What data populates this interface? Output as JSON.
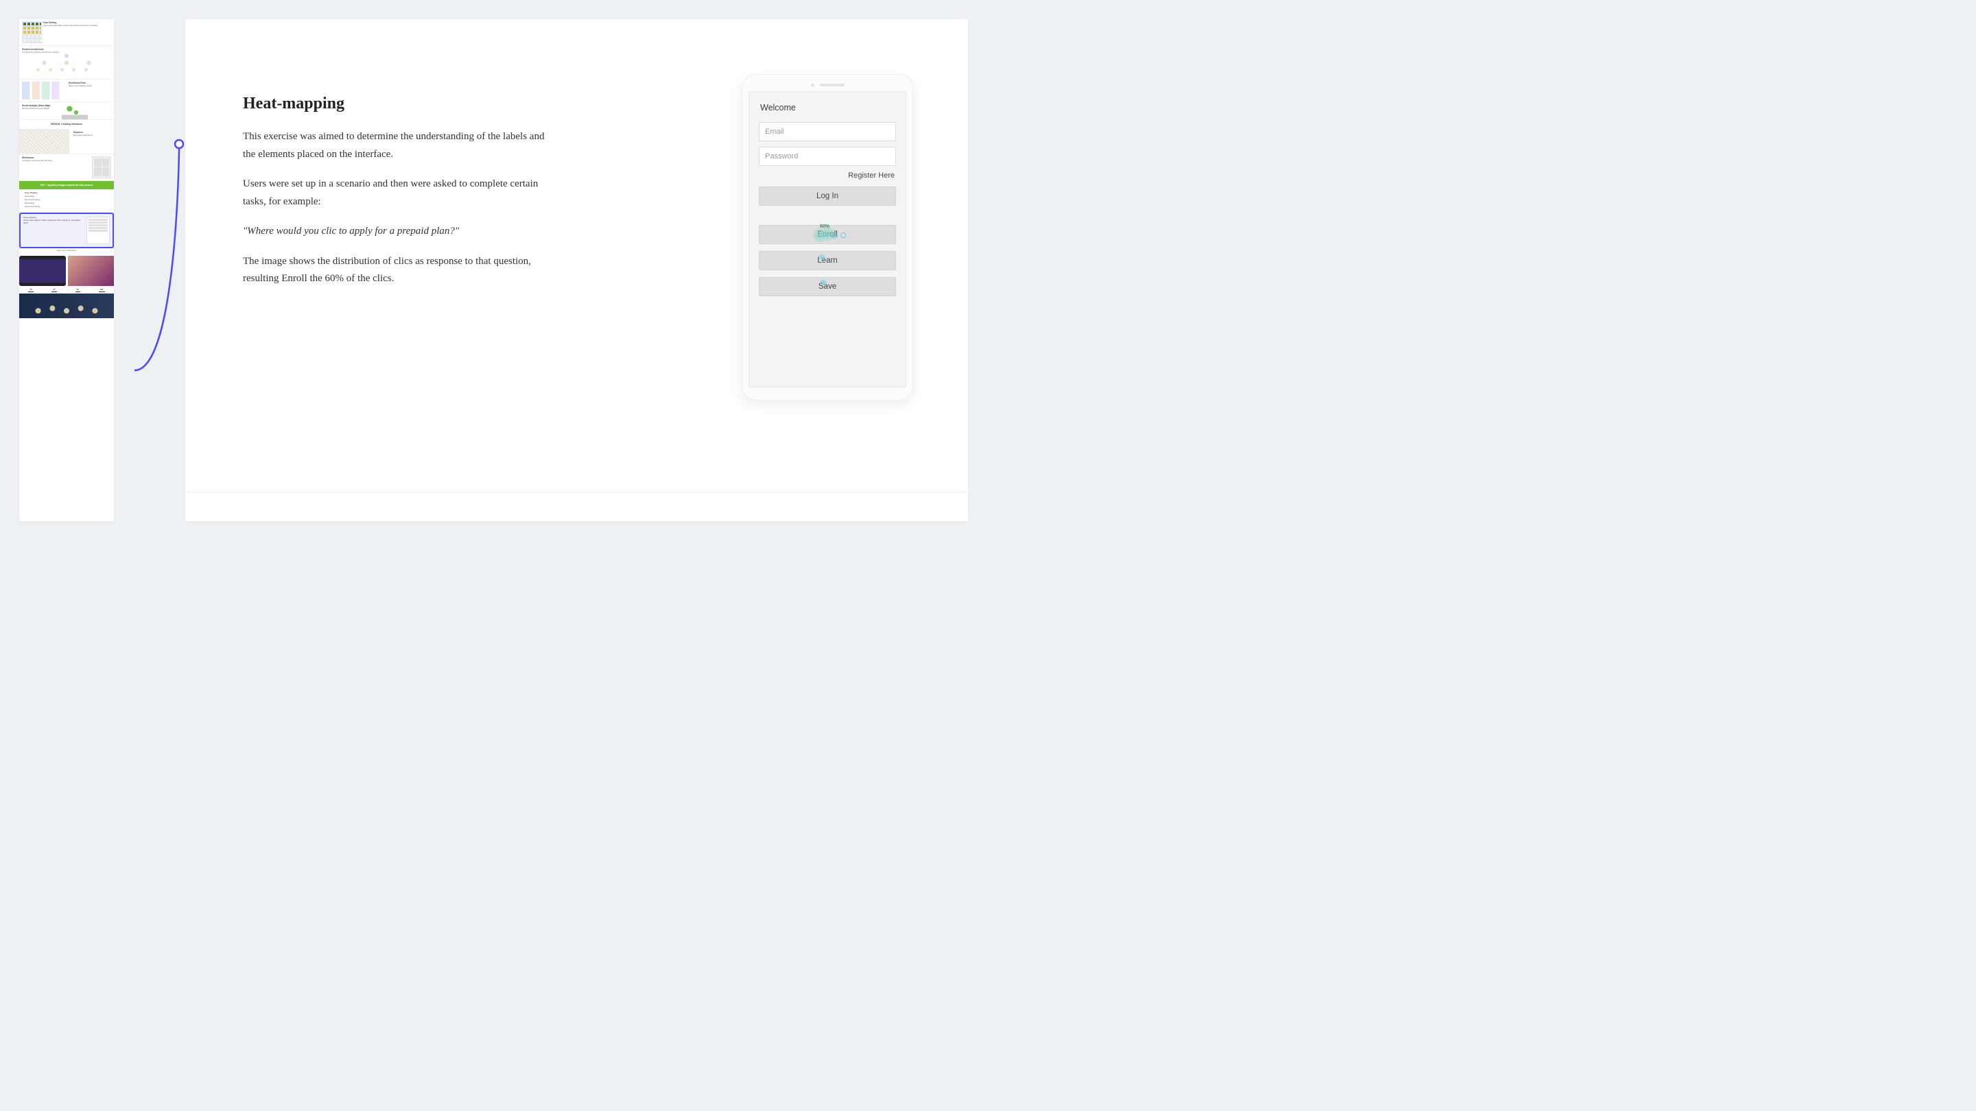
{
  "sidebar": {
    "sections": {
      "cardSorting": {
        "heading": "Card Sorting",
        "blurb": "Users sorted information cards to help define the structure and labels."
      },
      "productArch": {
        "heading": "Product Architecture",
        "blurb": "The hierarchy and flows derived from research."
      },
      "enrollmentFlow": {
        "heading": "Enrollment Flow",
        "blurb": "Steps a user follows to enroll."
      },
      "needsAnalysis": {
        "heading": "Needs analysis (Kano Map)",
        "blurb": "Prioritized features by user delight."
      },
      "designHeading": "DESIGN: Creating interfaces",
      "sketches": {
        "heading": "Sketches",
        "blurb": "Early paper explorations."
      },
      "wireframes": {
        "heading": "Wireframes",
        "blurb": "Low-fidelity screens for the main flows."
      },
      "greenBanner": "TEST : adjusting designs towards the final product.",
      "userTesting": {
        "heading": "User Testing",
        "blurb1": "Methodology",
        "blurb2": "Results and findings"
      },
      "selected": {
        "heading": "Heat-mapping",
        "blurb": "Users were asked: where would you clic to apply for a prepaid plan?"
      },
      "caption": "\"Even this is awesome\"",
      "stats": {
        "a": "20",
        "b": "67",
        "c": "98",
        "d": "100"
      }
    }
  },
  "main": {
    "title": "Heat-mapping",
    "p1": "This exercise was aimed to determine the understanding of the labels and the elements placed on the interface.",
    "p2": "Users were set up in a scenario and then were asked to complete certain tasks, for example:",
    "quote": "\"Where would you clic to apply for a prepaid plan?\"",
    "p3": "The image shows the distribution of clics as response to that question, resulting Enroll the 60% of the clics."
  },
  "phone": {
    "welcome": "Welcome",
    "email": "Email",
    "password": "Password",
    "register": "Register Here",
    "login": "Log In",
    "enroll": "Enroll",
    "enroll_pct": "60%",
    "learn": "Learn",
    "save": "Save"
  }
}
